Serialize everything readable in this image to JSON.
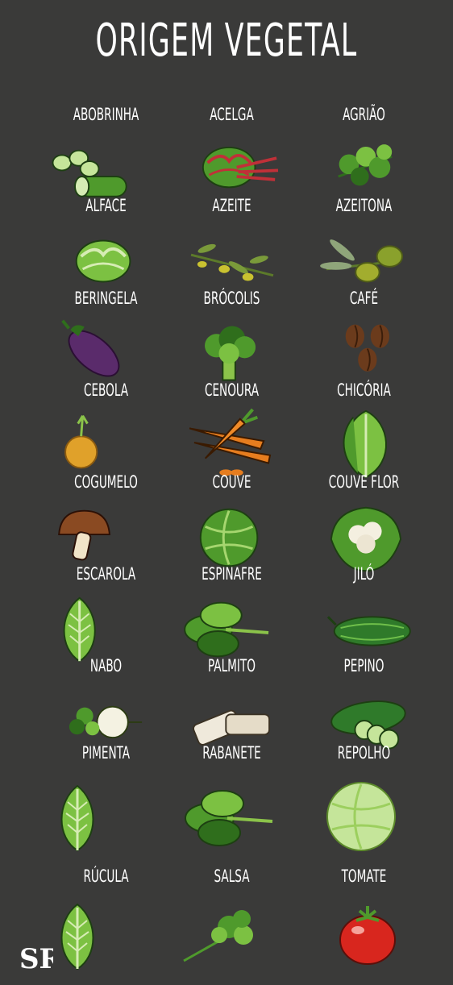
{
  "title": "ORIGEM VEGETAL",
  "items": [
    {
      "label": "ABOBRINHA",
      "icon": "zucchini-icon"
    },
    {
      "label": "ACELGA",
      "icon": "chard-icon"
    },
    {
      "label": "AGRIÃO",
      "icon": "watercress-icon"
    },
    {
      "label": "ALFACE",
      "icon": "lettuce-icon"
    },
    {
      "label": "AZEITE",
      "icon": "olive-branch-icon"
    },
    {
      "label": "AZEITONA",
      "icon": "olives-icon"
    },
    {
      "label": "BERINGELA",
      "icon": "eggplant-icon"
    },
    {
      "label": "BRÓCOLIS",
      "icon": "broccoli-icon"
    },
    {
      "label": "CAFÉ",
      "icon": "coffee-beans-icon"
    },
    {
      "label": "CEBOLA",
      "icon": "onion-icon"
    },
    {
      "label": "CENOURA",
      "icon": "carrots-icon"
    },
    {
      "label": "CHICÓRIA",
      "icon": "chicory-icon"
    },
    {
      "label": "COGUMELO",
      "icon": "mushroom-icon"
    },
    {
      "label": "COUVE",
      "icon": "cabbage-green-icon"
    },
    {
      "label": "COUVE FLOR",
      "icon": "cauliflower-icon"
    },
    {
      "label": "ESCAROLA",
      "icon": "escarole-icon"
    },
    {
      "label": "ESPINAFRE",
      "icon": "spinach-icon"
    },
    {
      "label": "JILÓ",
      "icon": "jilo-icon"
    },
    {
      "label": "NABO",
      "icon": "turnip-icon"
    },
    {
      "label": "PALMITO",
      "icon": "palm-heart-icon"
    },
    {
      "label": "PEPINO",
      "icon": "cucumber-icon"
    },
    {
      "label": "PIMENTA",
      "icon": "leaf-green-icon"
    },
    {
      "label": "RABANETE",
      "icon": "spinach-bunch-icon"
    },
    {
      "label": "REPOLHO",
      "icon": "cabbage-icon"
    },
    {
      "label": "RÚCULA",
      "icon": "arugula-icon"
    },
    {
      "label": "SALSA",
      "icon": "parsley-icon"
    },
    {
      "label": "TOMATE",
      "icon": "tomato-icon"
    }
  ],
  "logo": {
    "text": "SR",
    "icon": "sr-logo-icon"
  },
  "colors": {
    "background": "#3a3a39",
    "text": "#ffffff"
  }
}
